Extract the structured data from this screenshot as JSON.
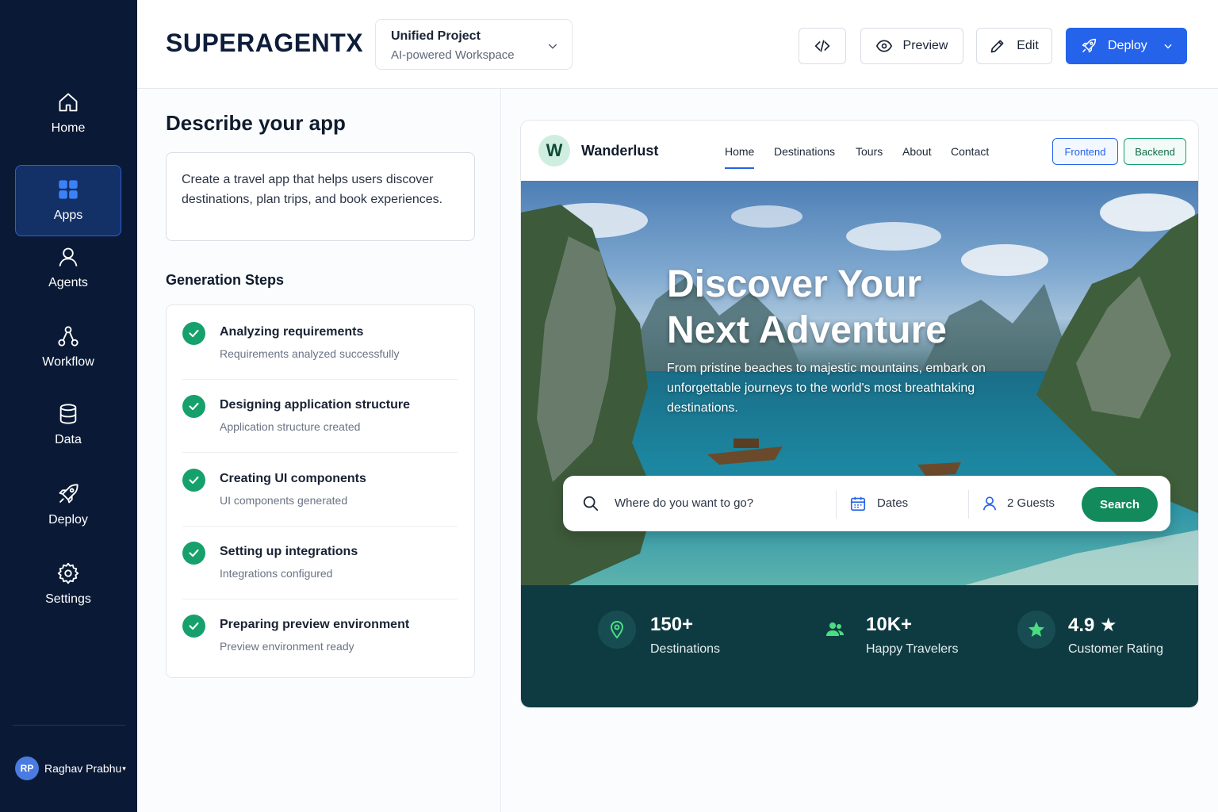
{
  "brand": "SUPERAGENTX",
  "project": {
    "title": "Unified Project",
    "subtitle": "AI-powered Workspace"
  },
  "toolbar": {
    "preview_label": "Preview",
    "edit_label": "Edit",
    "deploy_label": "Deploy"
  },
  "sidebar": {
    "items": [
      {
        "label": "Home",
        "icon": "home-icon"
      },
      {
        "label": "Apps",
        "icon": "apps-grid-icon",
        "active": true
      },
      {
        "label": "Agents",
        "icon": "user-icon"
      },
      {
        "label": "Workflow",
        "icon": "workflow-icon"
      },
      {
        "label": "Data",
        "icon": "database-icon"
      },
      {
        "label": "Deploy",
        "icon": "rocket-icon"
      },
      {
        "label": "Settings",
        "icon": "gear-icon"
      }
    ],
    "user": {
      "initials": "RP",
      "name": "Raghav Prabhu",
      "caret": "▾"
    }
  },
  "describe": {
    "heading": "Describe your app",
    "prompt": "Create a travel app that helps users discover destinations, plan trips, and book experiences."
  },
  "steps": {
    "heading": "Generation Steps",
    "items": [
      {
        "title": "Analyzing requirements",
        "subtitle": "Requirements analyzed successfully",
        "status": "done"
      },
      {
        "title": "Designing application structure",
        "subtitle": "Application structure created",
        "status": "done"
      },
      {
        "title": "Creating UI components",
        "subtitle": "UI components generated",
        "status": "done"
      },
      {
        "title": "Setting up integrations",
        "subtitle": "Integrations configured",
        "status": "done"
      },
      {
        "title": "Preparing preview environment",
        "subtitle": "Preview environment ready",
        "status": "done"
      }
    ]
  },
  "site": {
    "logo_letter": "W",
    "name": "Wanderlust",
    "nav": [
      "Home",
      "Destinations",
      "Tours",
      "About",
      "Contact"
    ],
    "tags": {
      "frontend": "Frontend",
      "backend": "Backend"
    },
    "hero": {
      "title_line1": "Discover Your",
      "title_line2": "Next Adventure",
      "subtitle": "From pristine beaches to majestic mountains, embark on unforgettable journeys to the world's most breathtaking destinations."
    },
    "search": {
      "destination_placeholder": "Where do you want to go?",
      "dates_label": "Dates",
      "guests_label": "2 Guests",
      "button_label": "Search"
    },
    "stats": [
      {
        "value": "150+",
        "label": "Destinations",
        "icon": "map-pin-icon"
      },
      {
        "value": "10K+",
        "label": "Happy Travelers",
        "icon": "users-icon"
      },
      {
        "value": "4.9 ★",
        "label": "Customer Rating",
        "icon": "star-icon"
      }
    ]
  },
  "colors": {
    "sidebar_bg": "#0a1a36",
    "accent_blue": "#2563eb",
    "success_green": "#16a06c",
    "stats_bg": "#0e3b42"
  }
}
